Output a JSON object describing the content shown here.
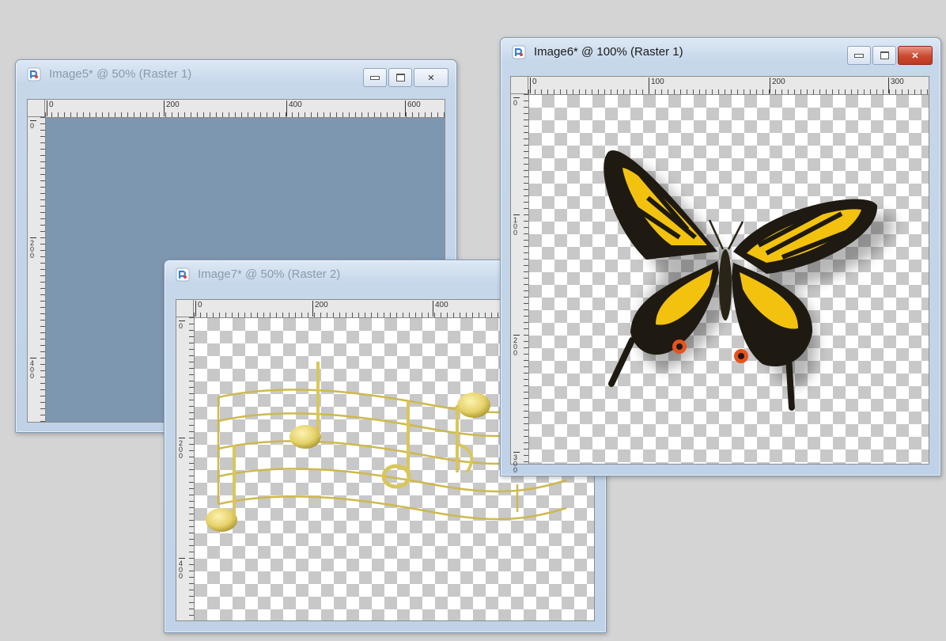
{
  "windows": {
    "image5": {
      "title": "Image5* @  50% (Raster 1)",
      "ruler_h": [
        "0",
        "200",
        "400",
        "600"
      ],
      "ruler_v": [
        "0",
        "200",
        "400"
      ],
      "canvas_color": "#7e97b0"
    },
    "image7": {
      "title": "Image7* @  50% (Raster 2)",
      "ruler_h": [
        "0",
        "200",
        "400"
      ],
      "ruler_v": [
        "0",
        "200",
        "400"
      ],
      "content": "musical-notes"
    },
    "image6": {
      "title": "Image6* @ 100% (Raster 1)",
      "ruler_h": [
        "0",
        "100",
        "200",
        "300"
      ],
      "ruler_v": [
        "0",
        "100",
        "200",
        "300"
      ],
      "content": "butterfly"
    }
  },
  "icons": {
    "app": "paintshop-pro-icon",
    "minimize": "minimize-icon",
    "maximize": "maximize-icon",
    "close": "close-icon"
  },
  "colors": {
    "desktop": "#d4d4d4",
    "close_button": "#c9492f",
    "checker_gray": "#c8c8c8"
  }
}
